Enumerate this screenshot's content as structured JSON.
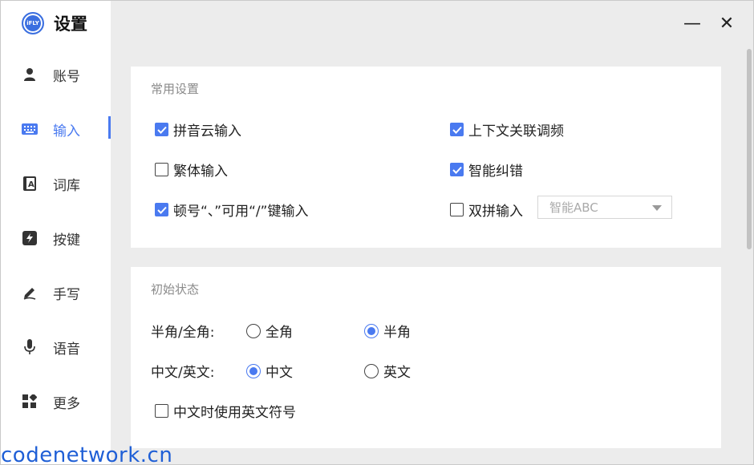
{
  "app": {
    "title": "设置",
    "logo_text": "iFLY"
  },
  "window_controls": {
    "minimize": "—",
    "close": "✕"
  },
  "sidebar": {
    "items": [
      {
        "label": "账号",
        "icon": "user-icon"
      },
      {
        "label": "输入",
        "icon": "keyboard-icon",
        "active": true
      },
      {
        "label": "词库",
        "icon": "dictionary-icon"
      },
      {
        "label": "按键",
        "icon": "lightning-icon"
      },
      {
        "label": "手写",
        "icon": "pen-icon"
      },
      {
        "label": "语音",
        "icon": "microphone-icon"
      },
      {
        "label": "更多",
        "icon": "grid-icon"
      }
    ]
  },
  "common_settings": {
    "title": "常用设置",
    "pinyin_cloud": {
      "label": "拼音云输入",
      "checked": true
    },
    "context_freq": {
      "label": "上下文关联调频",
      "checked": true
    },
    "traditional": {
      "label": "繁体输入",
      "checked": false
    },
    "smart_correct": {
      "label": "智能纠错",
      "checked": true
    },
    "pause_mark": {
      "label": "顿号“、”可用“/”键输入",
      "checked": true
    },
    "shuangpin": {
      "label": "双拼输入",
      "checked": false
    },
    "shuangpin_scheme": {
      "value": "智能ABC"
    }
  },
  "initial_state": {
    "title": "初始状态",
    "width_label": "半角/全角:",
    "full_width": {
      "label": "全角",
      "selected": false
    },
    "half_width": {
      "label": "半角",
      "selected": true
    },
    "lang_label": "中文/英文:",
    "chinese": {
      "label": "中文",
      "selected": true
    },
    "english": {
      "label": "英文",
      "selected": false
    },
    "english_punct": {
      "label": "中文时使用英文符号",
      "checked": false
    }
  },
  "watermark": "codenetwork.cn",
  "colors": {
    "accent": "#4a7af0",
    "watermark": "#1f5fd6"
  }
}
